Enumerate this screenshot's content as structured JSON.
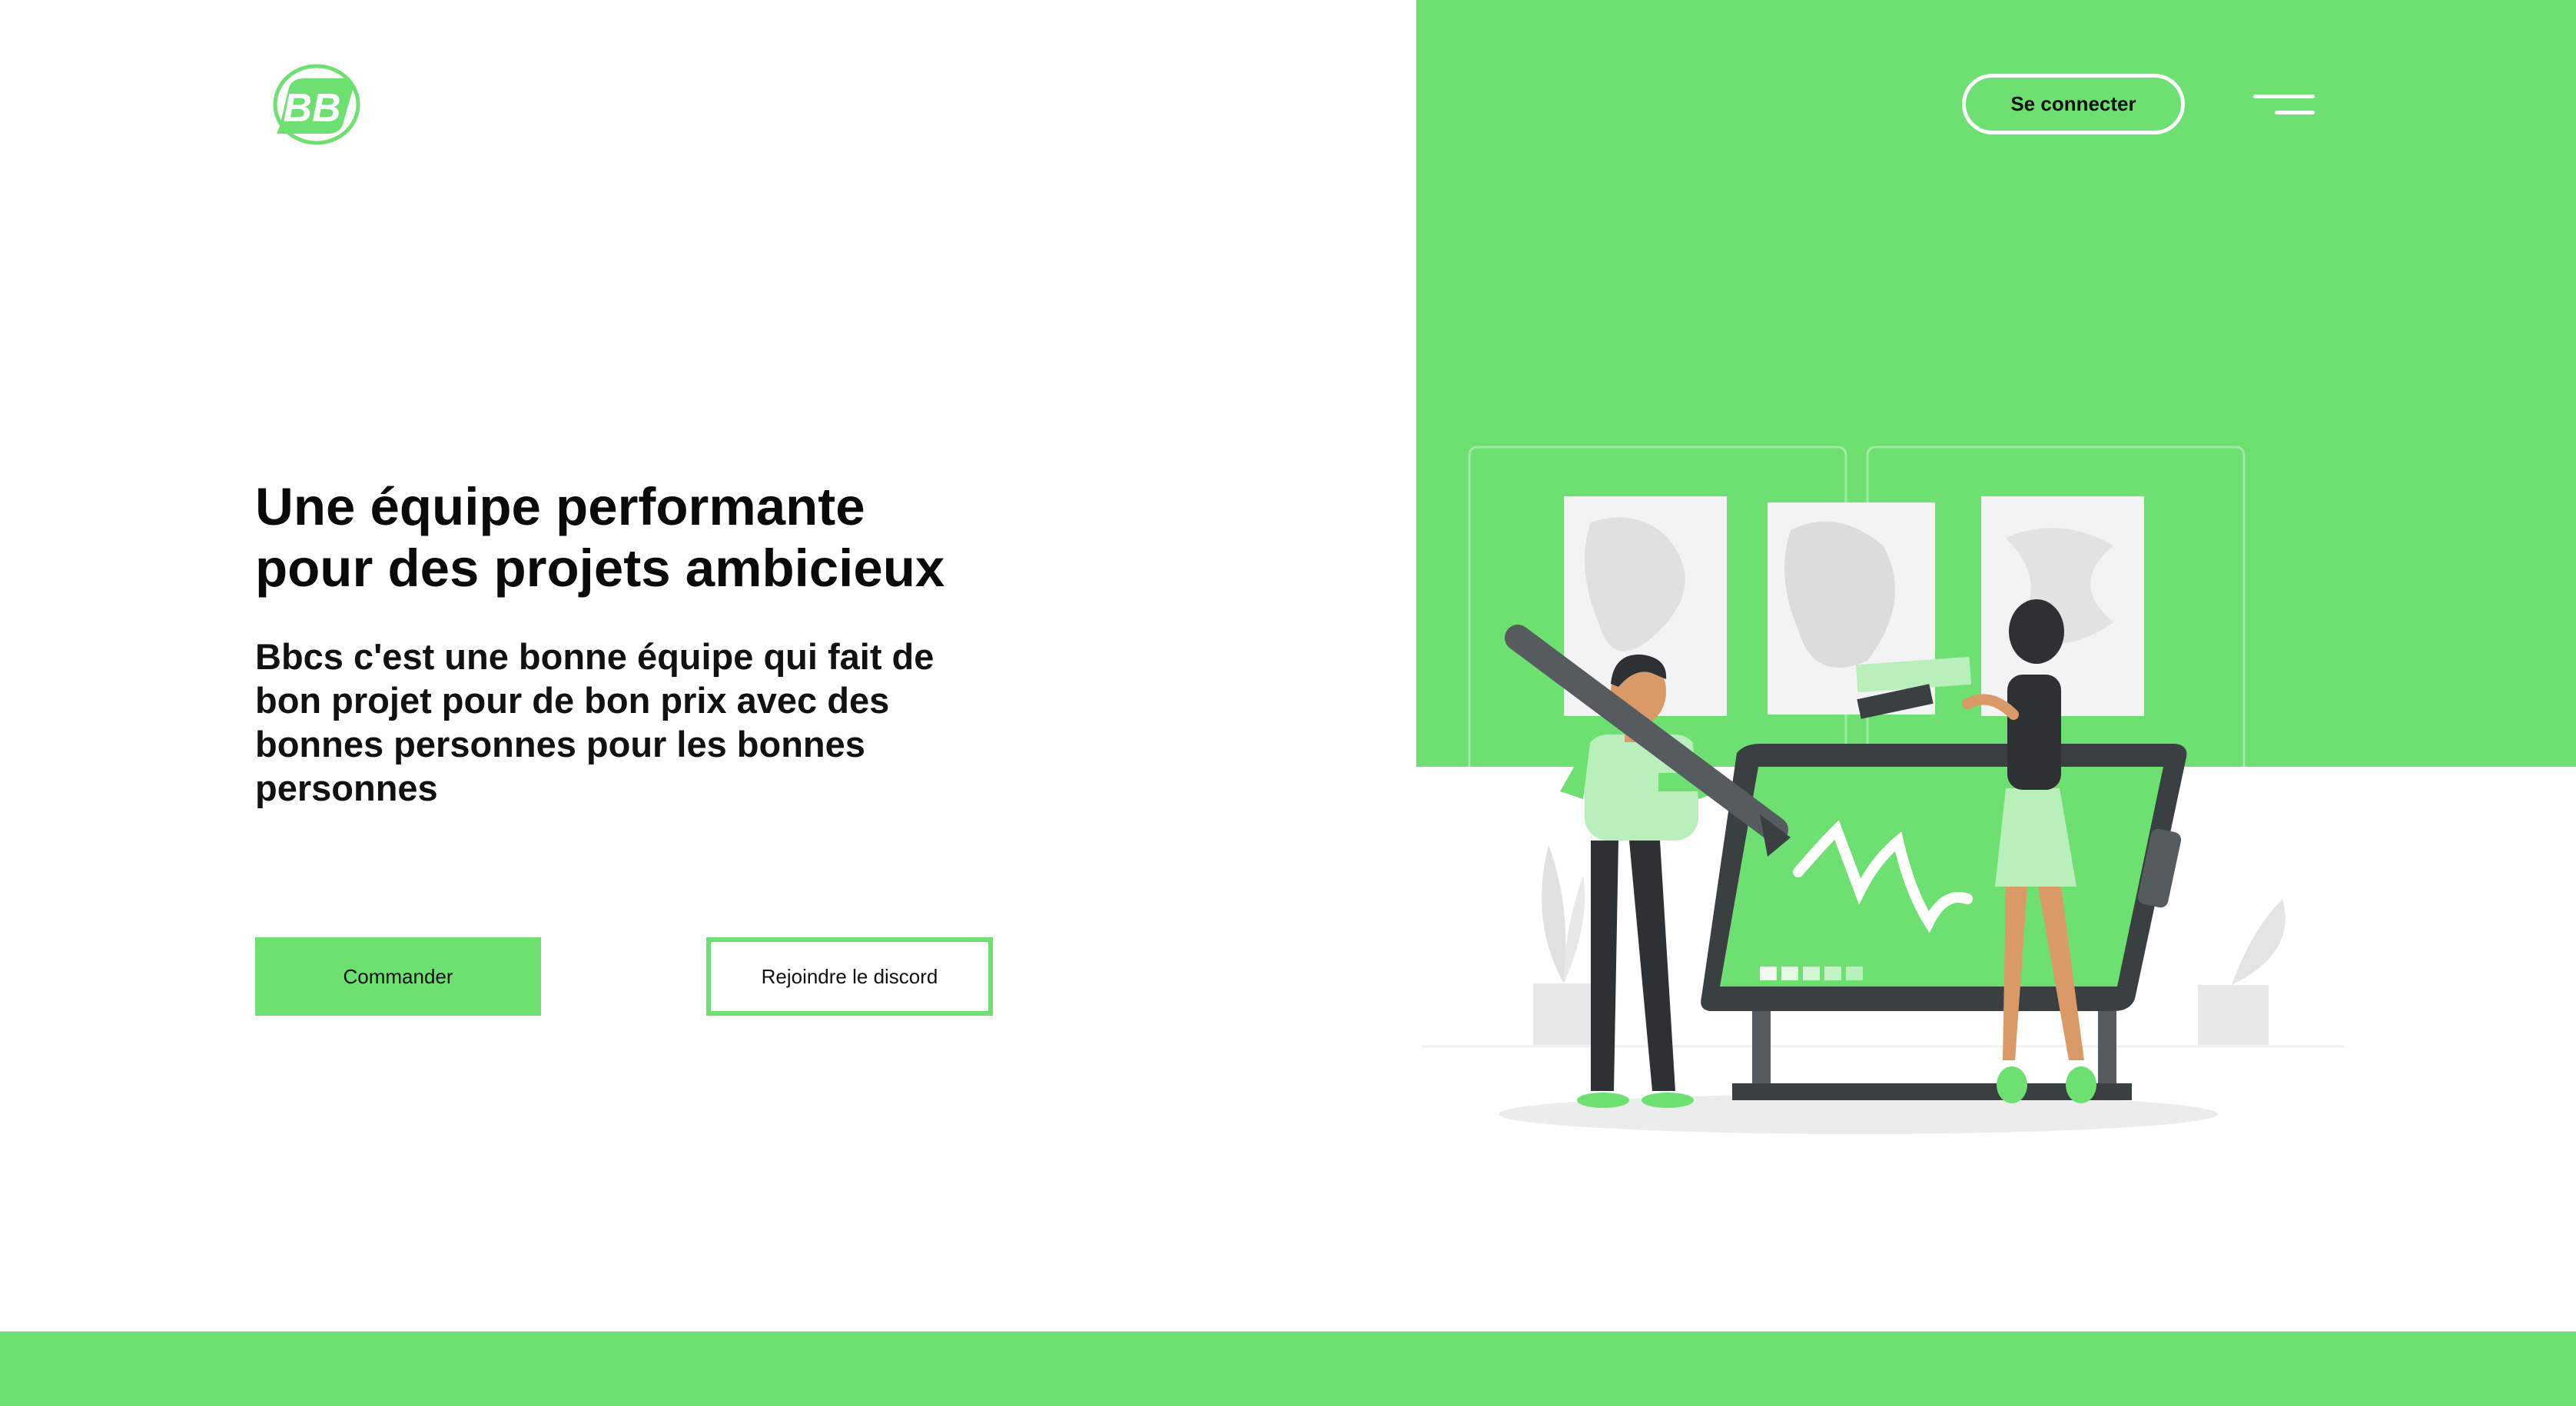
{
  "header": {
    "logo_icon": "bb-logo-icon",
    "login_label": "Se connecter",
    "menu_icon": "hamburger-menu-icon"
  },
  "hero": {
    "title_line1": "Une équipe performante",
    "title_line2": "pour des projets ambicieux",
    "text_line1": "Bbcs c'est une bonne équipe qui fait de",
    "text_line2": "bon projet pour de bon prix avec des",
    "text_line3": "bonnes personnes pour les bonnes",
    "text_line4": "personnes",
    "order_label": "Commander",
    "discord_label": "Rejoindre le discord"
  },
  "illustration": {
    "name": "designers-at-drawing-tablet-illustration"
  },
  "colors": {
    "accent": "#6ee072",
    "accent_light": "#b9efbb",
    "dark": "#2d3133",
    "text": "#0b0b0b",
    "background": "#ffffff"
  }
}
